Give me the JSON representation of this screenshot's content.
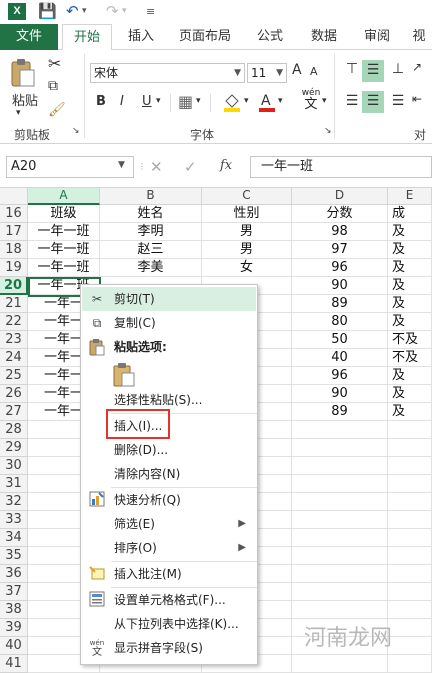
{
  "app": {
    "logo_letter": "X"
  },
  "tabs": [
    "文件",
    "开始",
    "插入",
    "页面布局",
    "公式",
    "数据",
    "审阅",
    "视"
  ],
  "ribbon": {
    "clipboard_label": "剪贴板",
    "paste_label": "粘贴",
    "font_group_label": "字体",
    "align_group_label": "对",
    "font_name": "宋体",
    "font_size": "11",
    "bold": "B",
    "italic": "I",
    "underline": "U",
    "size_up": "A",
    "size_down": "A",
    "phonetic": "wén",
    "phonetic_sub": "文"
  },
  "formula_bar": {
    "name_box": "A20",
    "fx": "fx",
    "value": "一年一班"
  },
  "grid": {
    "columns": [
      "A",
      "B",
      "C",
      "D",
      "E"
    ],
    "rows": [
      {
        "n": "16",
        "a": "班级",
        "b": "姓名",
        "c": "性别",
        "d": "分数",
        "e": "成"
      },
      {
        "n": "17",
        "a": "一年一班",
        "b": "李明",
        "c": "男",
        "d": "98",
        "e": "及"
      },
      {
        "n": "18",
        "a": "一年一班",
        "b": "赵三",
        "c": "男",
        "d": "97",
        "e": "及"
      },
      {
        "n": "19",
        "a": "一年一班",
        "b": "李美",
        "c": "女",
        "d": "96",
        "e": "及"
      },
      {
        "n": "20",
        "a": "一年一班",
        "b": "",
        "c": "",
        "d": "90",
        "e": "及"
      },
      {
        "n": "21",
        "a": "一年一",
        "b": "",
        "c": "",
        "d": "89",
        "e": "及"
      },
      {
        "n": "22",
        "a": "一年一",
        "b": "",
        "c": "",
        "d": "80",
        "e": "及"
      },
      {
        "n": "23",
        "a": "一年一",
        "b": "",
        "c": "",
        "d": "50",
        "e": "不及"
      },
      {
        "n": "24",
        "a": "一年一",
        "b": "",
        "c": "",
        "d": "40",
        "e": "不及"
      },
      {
        "n": "25",
        "a": "一年一",
        "b": "",
        "c": "",
        "d": "96",
        "e": "及"
      },
      {
        "n": "26",
        "a": "一年一",
        "b": "",
        "c": "",
        "d": "90",
        "e": "及"
      },
      {
        "n": "27",
        "a": "一年一",
        "b": "",
        "c": "",
        "d": "89",
        "e": "及"
      },
      {
        "n": "28",
        "a": "",
        "b": "",
        "c": "",
        "d": "",
        "e": ""
      },
      {
        "n": "29",
        "a": "",
        "b": "",
        "c": "",
        "d": "",
        "e": ""
      },
      {
        "n": "30",
        "a": "",
        "b": "",
        "c": "",
        "d": "",
        "e": ""
      },
      {
        "n": "31",
        "a": "",
        "b": "",
        "c": "",
        "d": "",
        "e": ""
      },
      {
        "n": "32",
        "a": "",
        "b": "",
        "c": "",
        "d": "",
        "e": ""
      },
      {
        "n": "33",
        "a": "",
        "b": "",
        "c": "",
        "d": "",
        "e": ""
      },
      {
        "n": "34",
        "a": "",
        "b": "",
        "c": "",
        "d": "",
        "e": ""
      },
      {
        "n": "35",
        "a": "",
        "b": "",
        "c": "",
        "d": "",
        "e": ""
      },
      {
        "n": "36",
        "a": "",
        "b": "",
        "c": "",
        "d": "",
        "e": ""
      },
      {
        "n": "37",
        "a": "",
        "b": "",
        "c": "",
        "d": "",
        "e": ""
      },
      {
        "n": "38",
        "a": "",
        "b": "",
        "c": "",
        "d": "",
        "e": ""
      },
      {
        "n": "39",
        "a": "",
        "b": "",
        "c": "",
        "d": "",
        "e": ""
      },
      {
        "n": "40",
        "a": "",
        "b": "",
        "c": "",
        "d": "",
        "e": ""
      },
      {
        "n": "41",
        "a": "",
        "b": "",
        "c": "",
        "d": "",
        "e": ""
      }
    ]
  },
  "context_menu": {
    "cut": "剪切(T)",
    "copy": "复制(C)",
    "paste_options": "粘贴选项:",
    "paste_special": "选择性粘贴(S)...",
    "insert": "插入(I)...",
    "delete": "删除(D)...",
    "clear": "清除内容(N)",
    "quick_analysis": "快速分析(Q)",
    "filter": "筛选(E)",
    "sort": "排序(O)",
    "insert_comment": "插入批注(M)",
    "format_cells": "设置单元格格式(F)...",
    "pick_list": "从下拉列表中选择(K)...",
    "phonetic": "显示拼音字段(S)"
  },
  "watermark": "河南龙网",
  "colors": {
    "excel_green": "#217346",
    "highlight": "#d9efe1",
    "insert_box": "#e5322d"
  }
}
